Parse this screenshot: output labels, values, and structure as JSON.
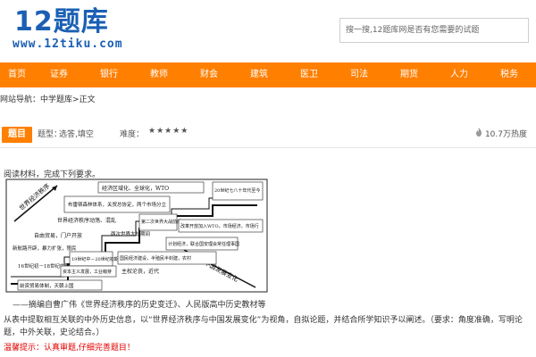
{
  "logo": {
    "main": "12题库",
    "url": "www.12tiku.com"
  },
  "search": {
    "placeholder": "搜一搜,12题库网是否有您需要的试题"
  },
  "nav": {
    "items": [
      "首页",
      "证券",
      "银行",
      "教师",
      "财会",
      "建筑",
      "医卫",
      "司法",
      "期货",
      "人力",
      "税务"
    ]
  },
  "breadcrumb": {
    "prefix": "网站导航：",
    "crumb1": "中学题库",
    "sep": ">",
    "crumb2": "正文"
  },
  "topic": {
    "tag": "题目",
    "type_label": "题型：",
    "type_value": "选答,填空",
    "difficulty_label": "难度：",
    "difficulty_value": "★★★★★",
    "heat": "10.7万热度",
    "heat_icon": "flame-icon"
  },
  "content": {
    "intro": "阅读材料，完成下列要求。",
    "figure": {
      "left_label_top": "世界经济秩序",
      "left_label_bottom": "中国发展变化",
      "boxes": [
        "经济区域化、全球化，WTO",
        "布雷顿森林体系，关贸总协定，两个市场分立",
        "世界经济秩序动荡、混乱",
        "第二次世界大战前后",
        "20世纪七八十年代至今",
        "改革开放加入WTO，市场经济，市场行",
        "两次世界大战期间",
        "计划经济，联合国安理会常任理事国",
        "自由贸易，门户开放",
        "新航路开辟，暴力扩张，殖民",
        "19世纪中－20世纪初期",
        "国民经济建设，半殖民半封建，农村",
        "16世纪初－18世纪中期",
        "资本主义发展，工业萌芽",
        "主权沦丧，近代",
        "前资贸易体制，天朝上国"
      ]
    },
    "source": "——摘编自曹广伟《世界经济秩序的历史变迁》、人民版高中历史教材等",
    "question": "从表中提取相互关联的中外历史信息，以“世界经济秩序与中国发展变化”为视角，自拟论题，并结合所学知识予以阐述。（要求：角度准确，写明论题，中外关联，史论结合。）",
    "tip": "温馨提示：认真审题,仔细完善题目！"
  }
}
